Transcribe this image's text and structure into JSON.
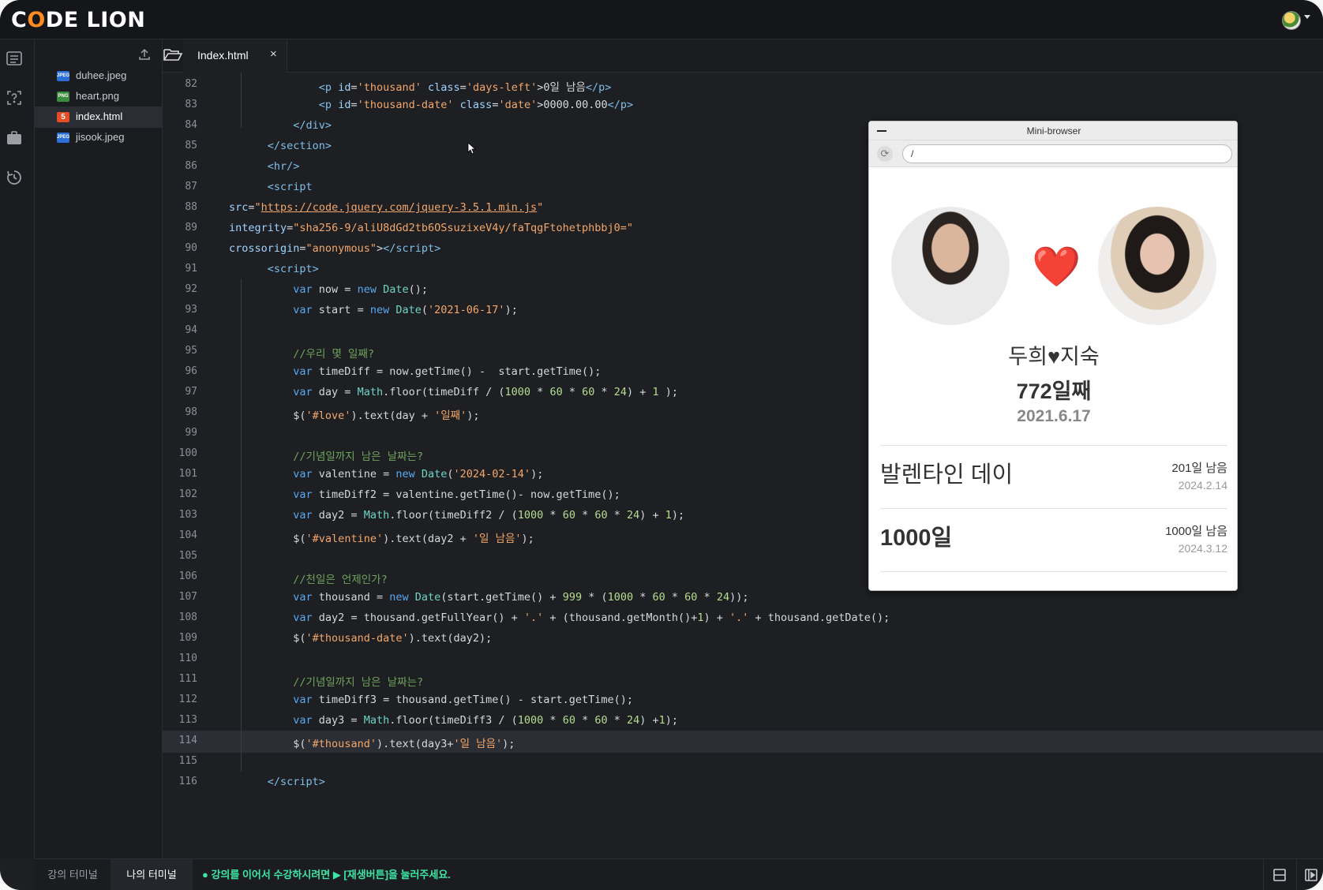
{
  "app": {
    "logo": "CODE LION"
  },
  "file_tree": {
    "files": [
      {
        "name": "duhee.jpeg",
        "type": "JPEG"
      },
      {
        "name": "heart.png",
        "type": "PNG"
      },
      {
        "name": "index.html",
        "type": "5"
      },
      {
        "name": "jisook.jpeg",
        "type": "JPEG"
      }
    ]
  },
  "tabs": [
    {
      "label": "Index.html",
      "close": "×"
    }
  ],
  "editor": {
    "lines": [
      {
        "num": "82"
      },
      {
        "num": "83"
      },
      {
        "num": "84"
      },
      {
        "num": "85"
      },
      {
        "num": "86"
      },
      {
        "num": "87"
      },
      {
        "num": "88"
      },
      {
        "num": "89"
      },
      {
        "num": "90"
      },
      {
        "num": "91"
      },
      {
        "num": "92"
      },
      {
        "num": "93"
      },
      {
        "num": "94"
      },
      {
        "num": "95"
      },
      {
        "num": "96"
      },
      {
        "num": "97"
      },
      {
        "num": "98"
      },
      {
        "num": "99"
      },
      {
        "num": "100"
      },
      {
        "num": "101"
      },
      {
        "num": "102"
      },
      {
        "num": "103"
      },
      {
        "num": "104"
      },
      {
        "num": "105"
      },
      {
        "num": "106"
      },
      {
        "num": "107"
      },
      {
        "num": "108"
      },
      {
        "num": "109"
      },
      {
        "num": "110"
      },
      {
        "num": "111"
      },
      {
        "num": "112"
      },
      {
        "num": "113"
      },
      {
        "num": "114"
      },
      {
        "num": "115"
      },
      {
        "num": "116"
      }
    ]
  },
  "mini_browser": {
    "title": "Mini-browser",
    "url": "/",
    "reload_icon": "⟳",
    "heart": "❤️",
    "names": "두희♥지숙",
    "days_count": "772일째",
    "start_date": "2021.6.17",
    "events": [
      {
        "title": "발렌타인 데이",
        "left": "201일 남음",
        "date": "2024.2.14"
      },
      {
        "title": "1000일",
        "left": "1000일 남음",
        "date": "2024.3.12"
      }
    ]
  },
  "bottom": {
    "tab_lecture": "강의 터미널",
    "tab_mine": "나의 터미널",
    "notice": "● 강의를 이어서 수강하시려면  ▶ [재생버튼]을 눌러주세요."
  },
  "colors": {
    "accent": "#ff8a1f",
    "notice": "#3ee6a5",
    "heart": "#e0131f"
  }
}
